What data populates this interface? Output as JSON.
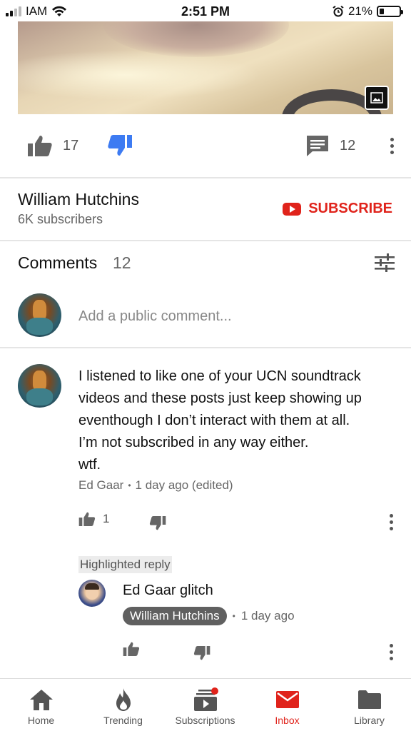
{
  "status_bar": {
    "carrier": "IAM",
    "time": "2:51 PM",
    "battery": "21%",
    "signal_bars_active": 2,
    "battery_level": 0.21
  },
  "video": {
    "like_count": "17",
    "comment_count": "12"
  },
  "channel": {
    "name": "William Hutchins",
    "subscribers": "6K subscribers",
    "subscribe_label": "SUBSCRIBE"
  },
  "comments": {
    "title": "Comments",
    "count": "12",
    "add_placeholder": "Add a public comment...",
    "items": [
      {
        "lines": [
          "I listened to like one of your UCN soundtrack",
          "videos and these posts just keep showing up",
          "eventhough I don’t interact with them at all.",
          "I’m not subscribed in any way either.",
          "wtf."
        ],
        "author": "Ed Gaar",
        "time": "1 day ago (edited)",
        "likes": "1"
      }
    ],
    "highlighted_label": "Highlighted reply",
    "reply": {
      "text": "Ed Gaar glitch",
      "author": "William Hutchins",
      "time": "1 day ago"
    }
  },
  "nav": {
    "items": [
      {
        "label": "Home",
        "icon": "home-icon"
      },
      {
        "label": "Trending",
        "icon": "flame-icon"
      },
      {
        "label": "Subscriptions",
        "icon": "subscriptions-icon"
      },
      {
        "label": "Inbox",
        "icon": "mail-icon"
      },
      {
        "label": "Library",
        "icon": "folder-icon"
      }
    ],
    "active": "Inbox"
  },
  "colors": {
    "accent_red": "#e0231b",
    "dislike_blue": "#3d7bf2",
    "text_gray": "#666666"
  }
}
